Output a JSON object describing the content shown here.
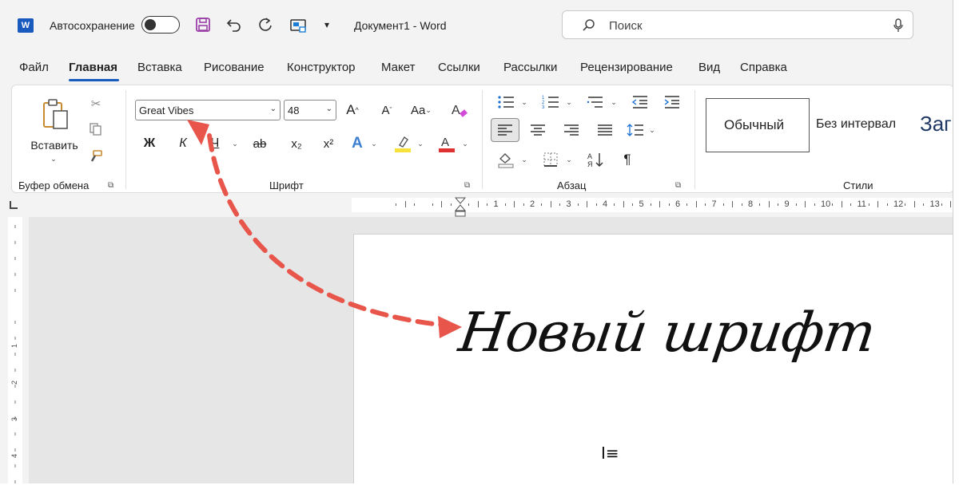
{
  "titlebar": {
    "app_icon": "W",
    "autosave_label": "Автосохранение",
    "doc_title": "Документ1  -  Word",
    "search_placeholder": "Поиск"
  },
  "menu": {
    "items": [
      "Файл",
      "Главная",
      "Вставка",
      "Рисование",
      "Конструктор",
      "Макет",
      "Ссылки",
      "Рассылки",
      "Рецензирование",
      "Вид",
      "Справка"
    ],
    "active": "Главная"
  },
  "ribbon": {
    "clipboard": {
      "paste_label": "Вставить",
      "group_label": "Буфер обмена"
    },
    "font": {
      "font_name": "Great Vibes",
      "font_size": "48",
      "bold": "Ж",
      "italic": "К",
      "underline": "Ч",
      "strike": "ab",
      "subscript": "x₂",
      "superscript": "x²",
      "group_label": "Шрифт"
    },
    "paragraph": {
      "group_label": "Абзац"
    },
    "styles": {
      "items": [
        "Обычный",
        "Без интервал",
        "Заг"
      ],
      "group_label": "Стили"
    }
  },
  "ruler": {
    "numbers": [
      "1",
      "2",
      "3",
      "4",
      "5",
      "6",
      "7",
      "8",
      "9",
      "10",
      "11",
      "12",
      "13"
    ]
  },
  "document": {
    "text": "Новый шрифт"
  },
  "colors": {
    "accent_arrow": "#e8554a",
    "word_blue": "#185abd",
    "font_color_bar": "#e03131",
    "highlight_bar": "#f7e23b"
  }
}
